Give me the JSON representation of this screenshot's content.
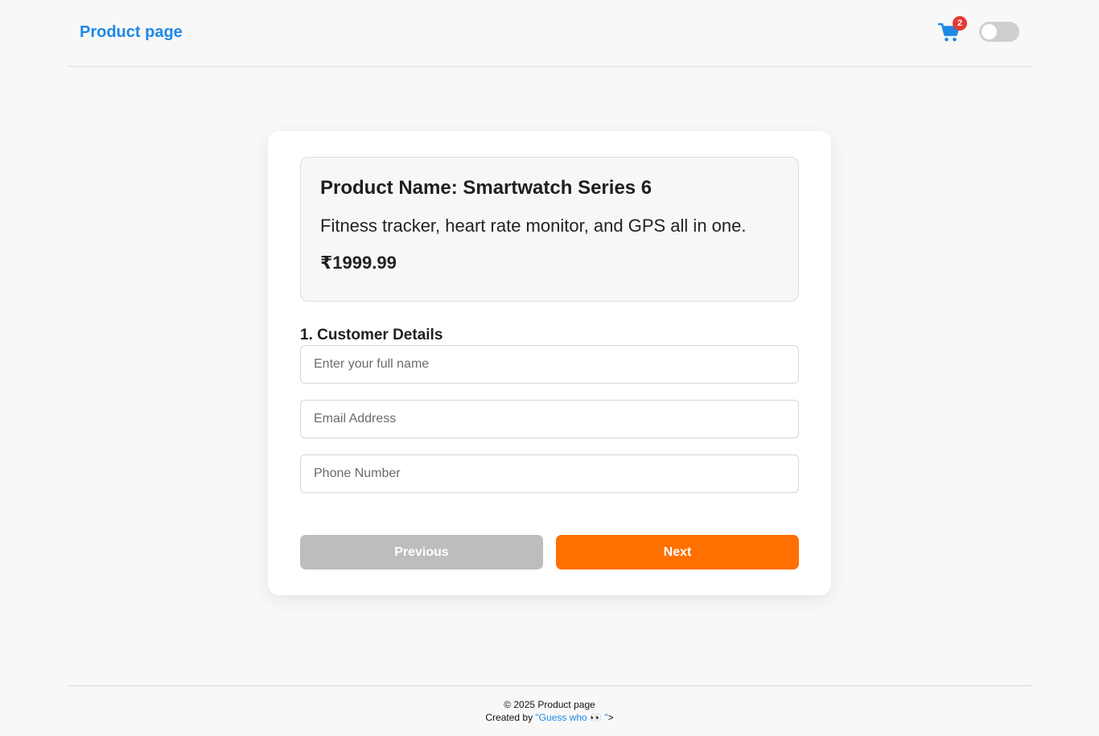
{
  "header": {
    "brand": "Product page",
    "cart_count": "2",
    "cart_icon": "shopping-cart-icon",
    "theme_toggle": "off"
  },
  "product": {
    "name": "Product Name: Smartwatch Series 6",
    "description": "Fitness tracker, heart rate monitor, and GPS all in one.",
    "price": "₹1999.99"
  },
  "form": {
    "section_title": "1. Customer Details",
    "name_placeholder": "Enter your full name",
    "email_placeholder": "Email Address",
    "phone_placeholder": "Phone Number",
    "previous_label": "Previous",
    "next_label": "Next"
  },
  "footer": {
    "copyright": "© 2025 Product page",
    "created_prefix": "Created by ",
    "created_link": "\"Guess who 👀 \"",
    "created_suffix": ">"
  },
  "colors": {
    "brand": "#1e88e5",
    "accent": "#ff7000",
    "badge": "#e53935",
    "disabled": "#bdbdbd"
  }
}
